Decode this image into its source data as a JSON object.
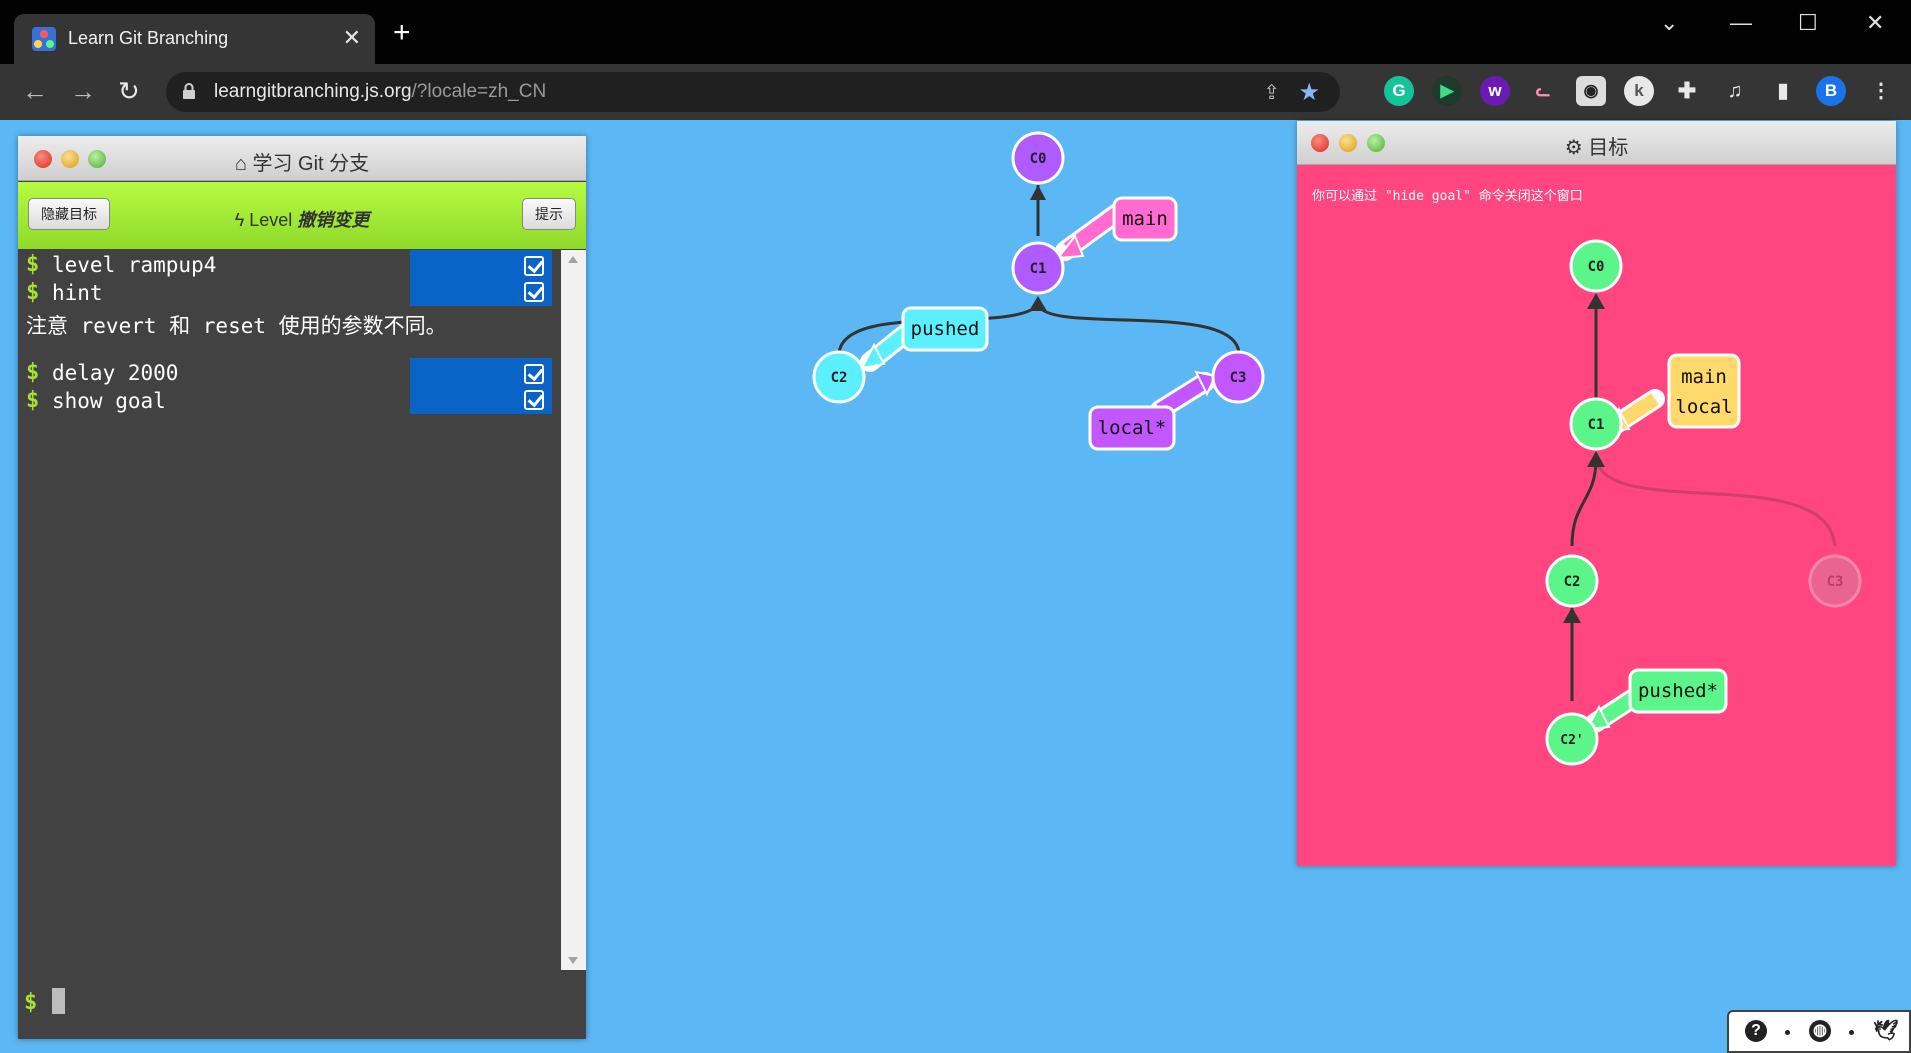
{
  "browser": {
    "tab_title": "Learn Git Branching",
    "url_host": "learngitbranching.js.org",
    "url_path": "/?locale=zh_CN",
    "profile_initial": "B",
    "extensions": [
      "grammarly-icon",
      "player-icon",
      "w-extension-icon",
      "cat-extension-icon",
      "glasses-extension-icon",
      "k-extension-icon",
      "puzzle-icon",
      "media-icon",
      "sidepanel-icon"
    ]
  },
  "command_window": {
    "title": "学习 Git 分支",
    "hide_goal_button": "隐藏目标",
    "level_prefix": "Level",
    "level_name": "撤销变更",
    "hint_button": "提示",
    "prompt": "$",
    "commands": [
      {
        "text": "level rampup4",
        "done": true
      },
      {
        "text": "hint",
        "done": true
      },
      {
        "text": "delay 2000",
        "done": true
      },
      {
        "text": "show goal",
        "done": true
      }
    ],
    "hint_text": "注意 revert 和 reset 使用的参数不同。"
  },
  "main_graph": {
    "commits": [
      "C0",
      "C1",
      "C2",
      "C3"
    ],
    "branches": {
      "main": "main",
      "pushed": "pushed",
      "local": "local*"
    },
    "colors": {
      "commit": "#b05bff",
      "main": "#ff6bd0",
      "pushed": "#5cf0ff",
      "local": "#c256ff"
    }
  },
  "goal_window": {
    "title": "目标",
    "hint": "你可以通过 \"hide goal\" 命令关闭这个窗口",
    "commits": [
      "C0",
      "C1",
      "C2",
      "C3",
      "C2'"
    ],
    "branches": {
      "main": "main",
      "local": "local",
      "pushed": "pushed*"
    },
    "colors": {
      "commit": "#5cf58a",
      "main": "#ffd96b",
      "pushed": "#5cf58a",
      "background": "#ff4681"
    }
  },
  "footer": {
    "icons": [
      "help-icon",
      "globe-icon",
      "twitter-icon"
    ]
  }
}
